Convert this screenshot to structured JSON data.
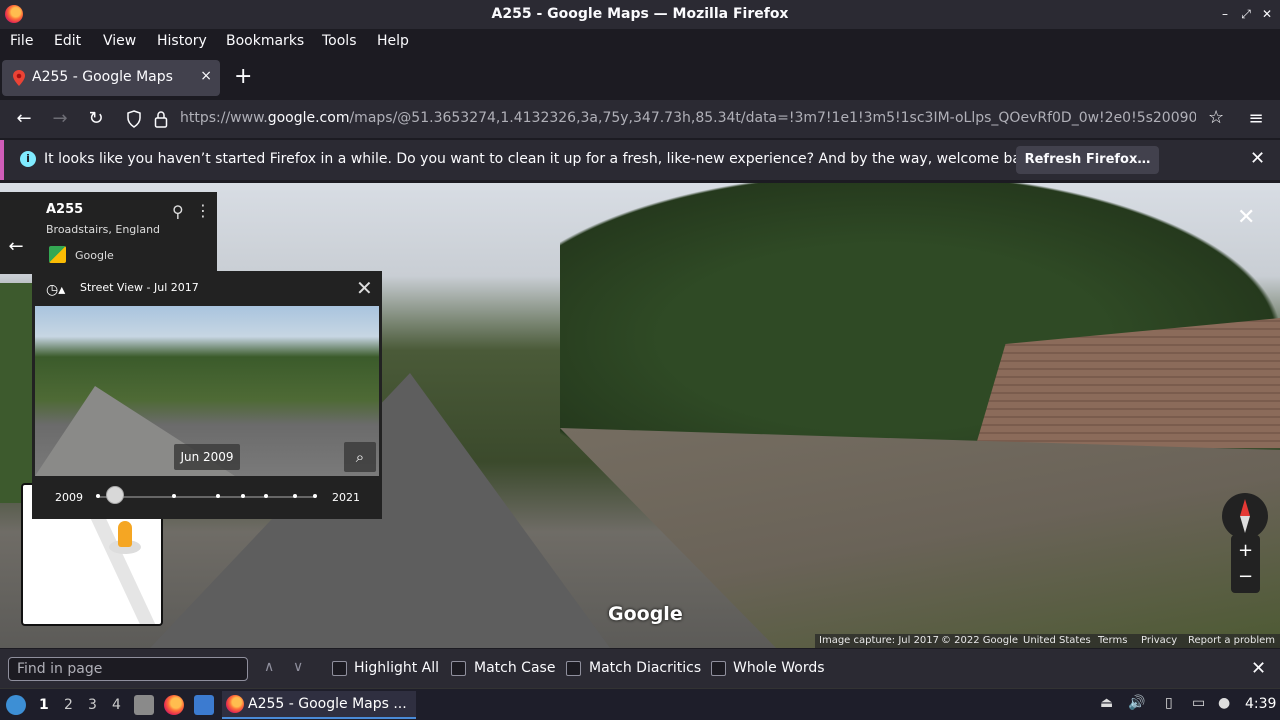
{
  "window": {
    "title": "A255 - Google Maps — Mozilla Firefox"
  },
  "menubar": {
    "items": [
      "File",
      "Edit",
      "View",
      "History",
      "Bookmarks",
      "Tools",
      "Help"
    ]
  },
  "tab": {
    "label": "A255 - Google Maps",
    "close": "×",
    "new_tab": "+"
  },
  "navbar": {
    "url_prefix": "https://www.",
    "url_host": "google.com",
    "url_rest": "/maps/@51.3653274,1.4132326,3a,75y,347.73h,85.34t/data=!3m7!1e1!3m5!1sc3IM-oLlps_QOevRf0D_0w!2e0!5s20090"
  },
  "notification": {
    "message": "It looks like you haven’t started Firefox in a while. Do you want to clean it up for a fresh, like-new experience? And by the way, welcome back!",
    "button": "Refresh Firefox…"
  },
  "streetview": {
    "place_name": "A255",
    "place_sub": "Broadstairs, England",
    "source": "Google",
    "panel_header": "Street View - Jul 2017",
    "thumb_date": "Jun 2009",
    "year_start": "2009",
    "year_end": "2021",
    "slider_position": 0.08,
    "watermark": "Google",
    "footer": {
      "capture": "Image capture: Jul 2017",
      "copyright": "© 2022 Google",
      "region": "United States",
      "terms": "Terms",
      "privacy": "Privacy",
      "report": "Report a problem"
    }
  },
  "findbar": {
    "placeholder": "Find in page",
    "highlight_all": "Highlight All",
    "match_case": "Match Case",
    "match_diacritics": "Match Diacritics",
    "whole_words": "Whole Words"
  },
  "taskbar": {
    "workspaces": [
      "1",
      "2",
      "3",
      "4"
    ],
    "task_label": "A255 - Google Maps ...",
    "clock": "4:39"
  },
  "colors": {
    "accent": "#d05db9",
    "info": "#80ebff",
    "toolbar": "#2b2a33"
  }
}
